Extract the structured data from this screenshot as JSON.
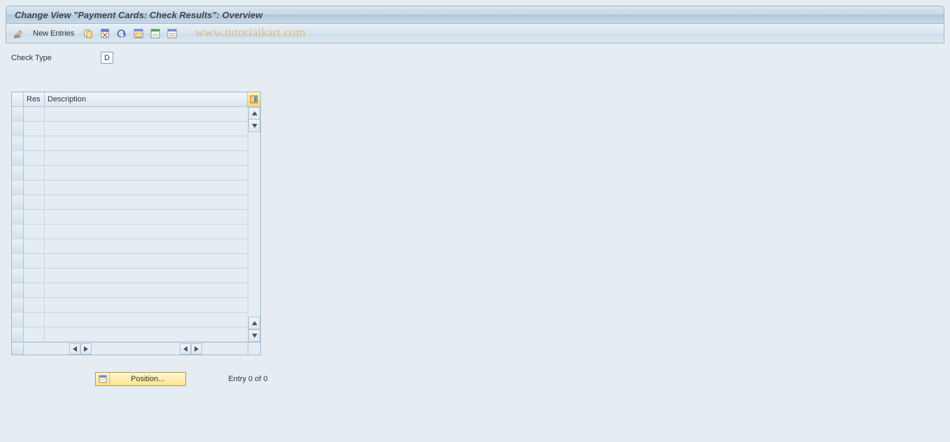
{
  "header": {
    "title": "Change View \"Payment Cards: Check Results\": Overview"
  },
  "toolbar": {
    "new_entries_label": "New Entries"
  },
  "watermark": "www.tutorialkart.com",
  "fields": {
    "check_type": {
      "label": "Check Type",
      "value": "D"
    }
  },
  "table": {
    "columns": {
      "res": "Res",
      "description": "Description"
    },
    "row_count": 16,
    "rows": []
  },
  "footer": {
    "position_label": "Position...",
    "entry_text": "Entry 0 of 0"
  }
}
